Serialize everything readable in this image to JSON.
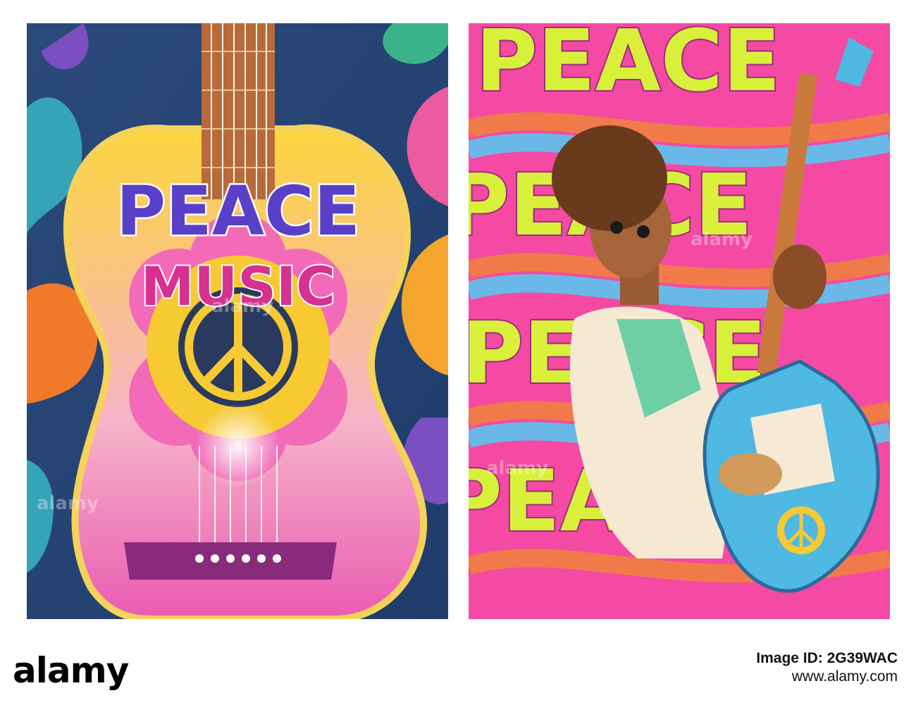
{
  "poster_left": {
    "title_line1": "PEACE",
    "title_line2": "MUSIC"
  },
  "poster_right": {
    "background_word": "PEACE"
  },
  "watermark": {
    "text": "alamy"
  },
  "footer": {
    "logo": "alamy",
    "image_id": "Image ID: 2G39WAC",
    "url": "www.alamy.com"
  },
  "colors": {
    "title_blue": "#5a3fc8",
    "title_pink": "#d6318f",
    "guitar_yellow": "#f7c933",
    "flower_pink": "#f26ab8",
    "peace_dark": "#2a3a5e",
    "electric_blue": "#4fb8e3"
  },
  "icons": [
    "peace-sign-icon",
    "guitar-icon",
    "electric-guitar-icon"
  ]
}
